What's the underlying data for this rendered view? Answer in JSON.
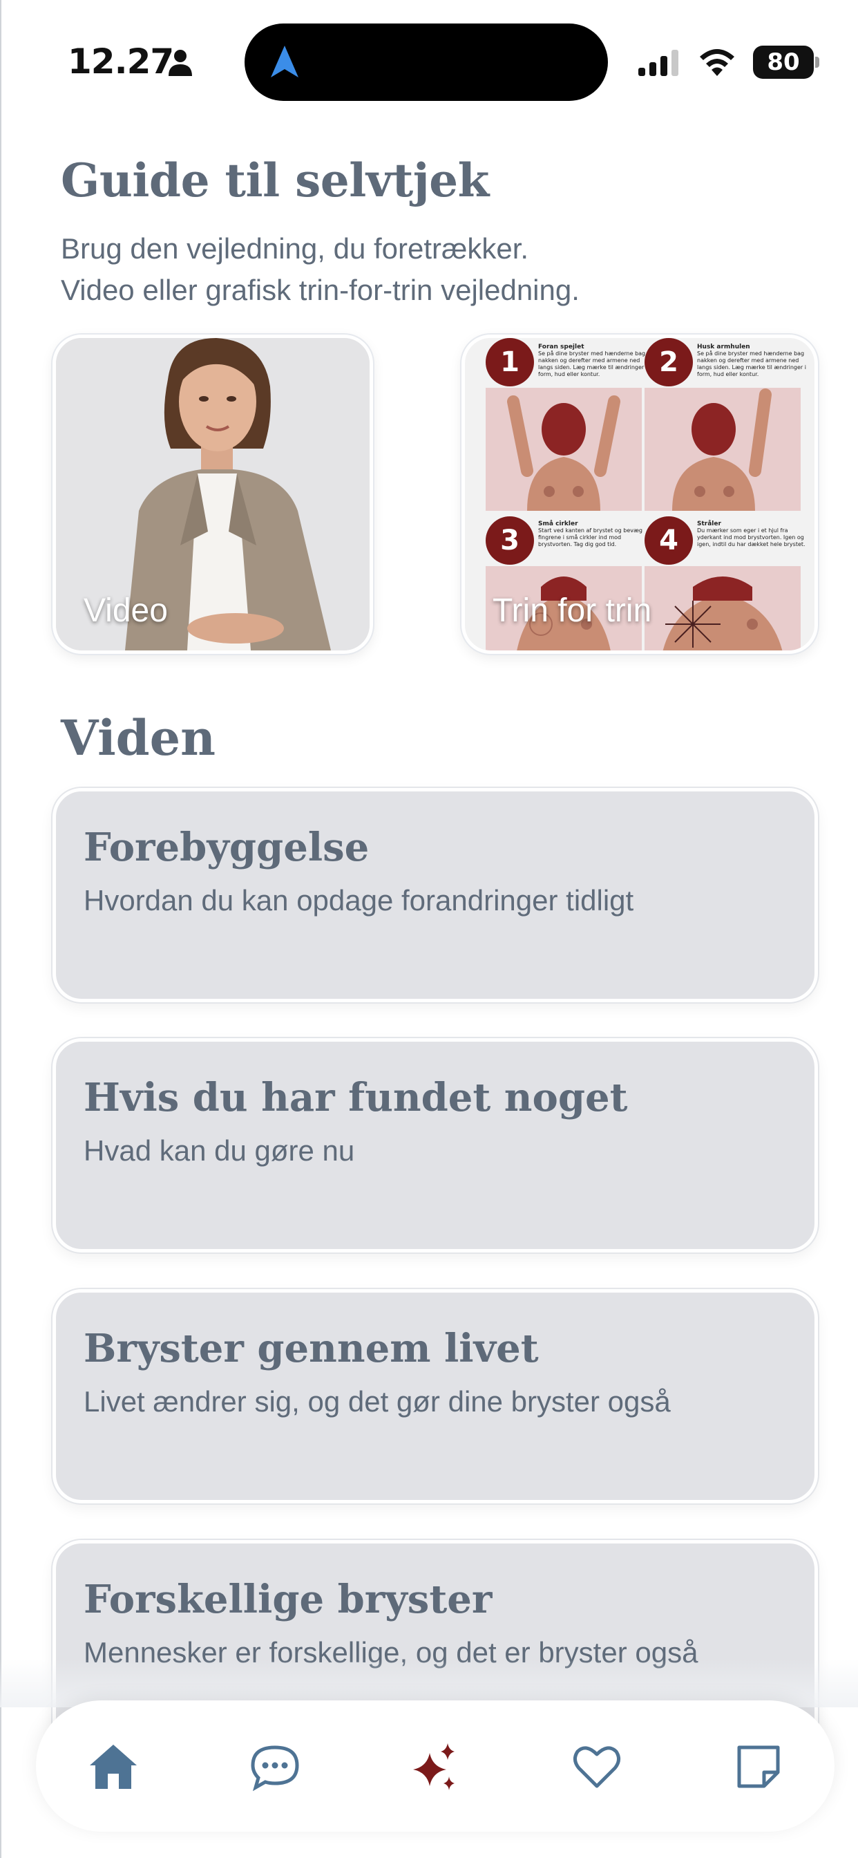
{
  "status_bar": {
    "time": "12.27",
    "battery": "80"
  },
  "guide": {
    "title": "Guide til selvtjek",
    "subtitle_line1": "Brug den vejledning, du foretrækker.",
    "subtitle_line2": "Video eller grafisk trin-for-trin vejledning.",
    "cards": [
      {
        "label": "Video",
        "icon": "person-photo"
      },
      {
        "label": "Trin for trin",
        "icon": "step-illustration"
      }
    ],
    "steps": [
      {
        "num": "1",
        "title": "Foran spejlet",
        "text": "Se på dine bryster med hænderne bag nakken og derefter med armene ned langs siden. Læg mærke til ændringer i form, hud eller kontur."
      },
      {
        "num": "2",
        "title": "Husk armhulen",
        "text": "Se på dine bryster med hænderne bag nakken og derefter med armene ned langs siden. Læg mærke til ændringer i form, hud eller kontur."
      },
      {
        "num": "3",
        "title": "Små cirkler",
        "text": "Start ved kanten af brystet og bevæg fingrene i små cirkler ind mod brystvorten. Tag dig god tid."
      },
      {
        "num": "4",
        "title": "Stråler",
        "text": "Du mærker som eger i et hjul fra yderkant ind mod brystvorten. Igen og igen, indtil du har dækket hele brystet."
      }
    ]
  },
  "viden": {
    "title": "Viden",
    "items": [
      {
        "title": "Forebyggelse",
        "subtitle": "Hvordan du kan opdage forandringer tidligt"
      },
      {
        "title": "Hvis du har fundet noget",
        "subtitle": "Hvad kan du gøre nu"
      },
      {
        "title": "Bryster gennem livet",
        "subtitle": "Livet ændrer sig, og det gør dine bryster også"
      },
      {
        "title": "Forskellige bryster",
        "subtitle": "Mennesker er forskellige, og det er bryster også"
      }
    ]
  },
  "tab_bar": {
    "tabs": [
      {
        "icon": "home-icon",
        "active": true
      },
      {
        "icon": "chat-icon",
        "active": false
      },
      {
        "icon": "sparkles-icon",
        "active": false
      },
      {
        "icon": "heart-icon",
        "active": false
      },
      {
        "icon": "note-icon",
        "active": false
      }
    ]
  },
  "colors": {
    "heading": "#5e6a79",
    "card_bg": "#e1e2e6",
    "accent_blue": "#4e7394",
    "accent_red": "#7b1a1a"
  }
}
